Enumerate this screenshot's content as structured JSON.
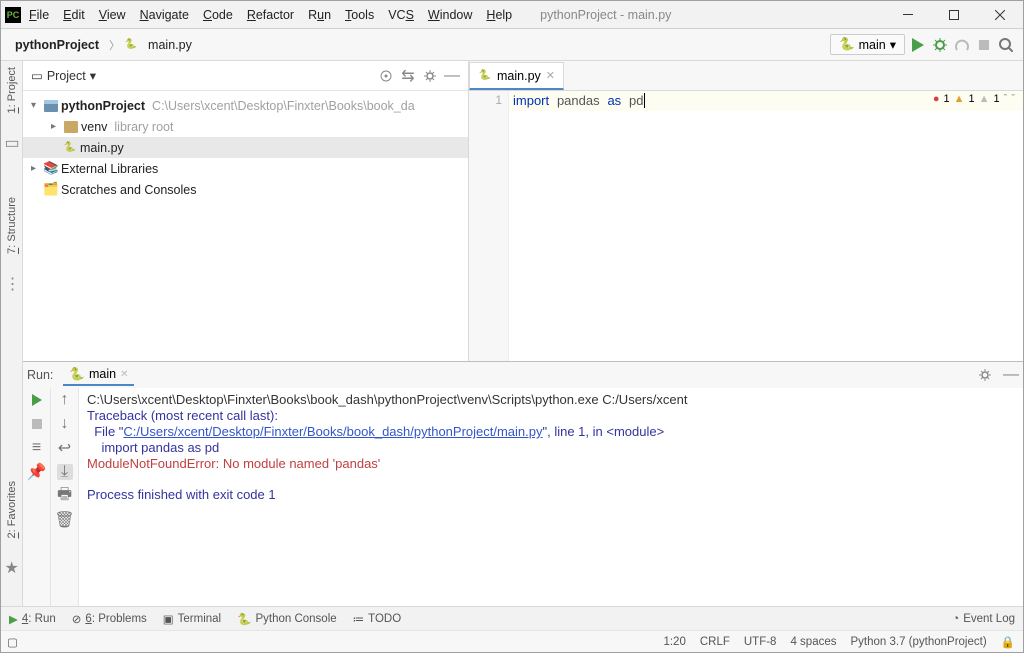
{
  "window": {
    "title": "pythonProject - main.py"
  },
  "menu": [
    "File",
    "Edit",
    "View",
    "Navigate",
    "Code",
    "Refactor",
    "Run",
    "Tools",
    "VCS",
    "Window",
    "Help"
  ],
  "breadcrumbs": {
    "project": "pythonProject",
    "file": "main.py"
  },
  "run_config": "main",
  "project_panel": {
    "title": "Project",
    "root": {
      "name": "pythonProject",
      "path": "C:\\Users\\xcent\\Desktop\\Finxter\\Books\\book_da"
    },
    "venv": {
      "name": "venv",
      "tag": "library root"
    },
    "file": "main.py",
    "ext_lib": "External Libraries",
    "scratches": "Scratches and Consoles"
  },
  "editor": {
    "tab": "main.py",
    "line_no": "1",
    "code": {
      "kw": "import",
      "mod": "pandas",
      "as": "as",
      "alias": "pd"
    },
    "inspections": {
      "errors": "1",
      "warnings": "1",
      "weak": "1"
    }
  },
  "run": {
    "label": "Run:",
    "tab": "main",
    "lines": {
      "cmd": "C:\\Users\\xcent\\Desktop\\Finxter\\Books\\book_dash\\pythonProject\\venv\\Scripts\\python.exe C:/Users/xcent",
      "trace": "Traceback (most recent call last):",
      "file_pre": "  File \"",
      "file_link": "C:/Users/xcent/Desktop/Finxter/Books/book_dash/pythonProject/main.py",
      "file_post": "\", line 1, in <module>",
      "import": "    import pandas as pd",
      "error": "ModuleNotFoundError: No module named 'pandas'",
      "exit": "Process finished with exit code 1"
    }
  },
  "bottom": {
    "run": "4: Run",
    "problems": "6: Problems",
    "terminal": "Terminal",
    "pyconsole": "Python Console",
    "todo": "TODO",
    "eventlog": "Event Log"
  },
  "status": {
    "pos": "1:20",
    "eol": "CRLF",
    "enc": "UTF-8",
    "indent": "4 spaces",
    "interp": "Python 3.7 (pythonProject)"
  }
}
